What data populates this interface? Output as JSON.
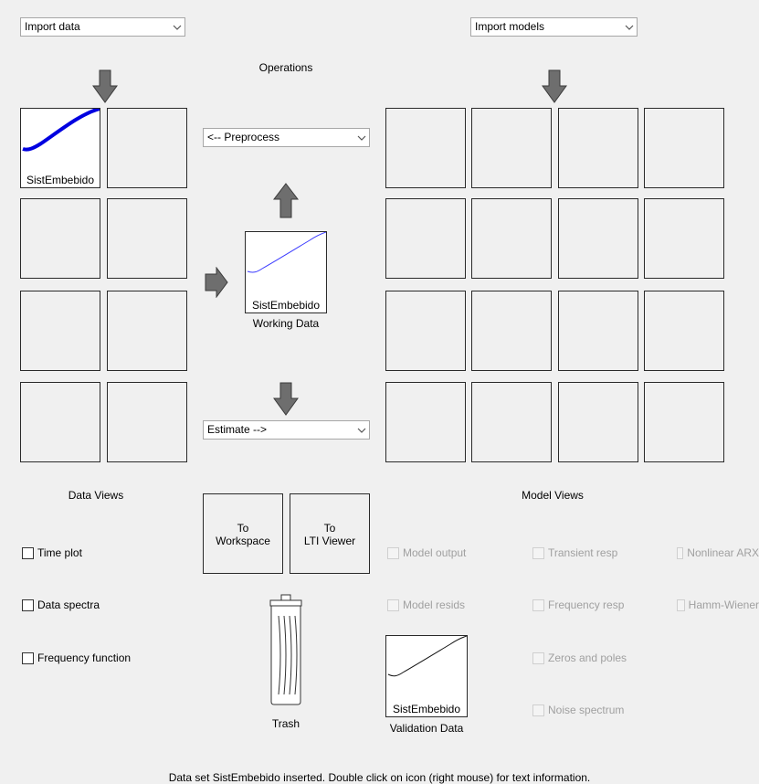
{
  "import_data": {
    "value": "Import data"
  },
  "import_models": {
    "value": "Import models"
  },
  "operations": {
    "title": "Operations",
    "preprocess": "<-- Preprocess",
    "estimate": "Estimate -->"
  },
  "data_board": {
    "slot1_label": "SistEmbebido"
  },
  "working_data": {
    "icon_label": "SistEmbebido",
    "caption": "Working Data"
  },
  "validation_data": {
    "icon_label": "SistEmbebido",
    "caption": "Validation Data"
  },
  "data_views": {
    "title": "Data Views",
    "items": [
      "Time plot",
      "Data spectra",
      "Frequency function"
    ]
  },
  "model_views": {
    "title": "Model Views",
    "items": [
      "Model output",
      "Model resids",
      "Transient resp",
      "Frequency resp",
      "Zeros and poles",
      "Noise spectrum",
      "Nonlinear ARX",
      "Hamm-Wiener"
    ]
  },
  "buttons": {
    "to_workspace_1": "To",
    "to_workspace_2": "Workspace",
    "to_lti_1": "To",
    "to_lti_2": "LTI Viewer"
  },
  "trash": {
    "label": "Trash"
  },
  "status": "Data set SistEmbebido inserted.  Double click on icon (right mouse) for text information.",
  "colors": {
    "data_line": "#0000e0",
    "arrow": "#6e6e6e",
    "background": "#f0f0f0"
  }
}
